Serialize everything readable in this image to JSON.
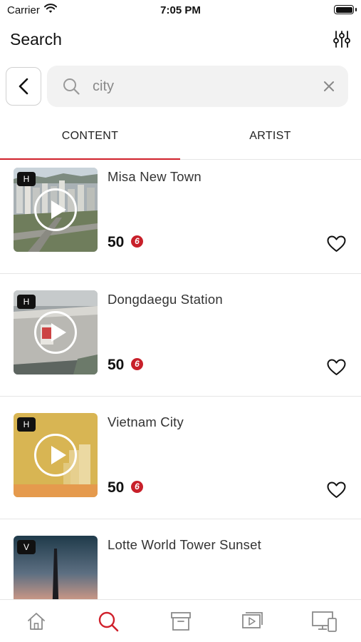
{
  "status_bar": {
    "carrier": "Carrier",
    "time": "7:05 PM"
  },
  "header": {
    "title": "Search"
  },
  "search": {
    "value": "city"
  },
  "tabs": [
    {
      "label": "CONTENT",
      "active": true
    },
    {
      "label": "ARTIST",
      "active": false
    }
  ],
  "results": [
    {
      "title": "Misa New Town",
      "price": "50",
      "badge": "H",
      "coin_symbol": "6"
    },
    {
      "title": "Dongdaegu Station",
      "price": "50",
      "badge": "H",
      "coin_symbol": "6"
    },
    {
      "title": "Vietnam City",
      "price": "50",
      "badge": "H",
      "coin_symbol": "6"
    },
    {
      "title": "Lotte World Tower Sunset",
      "badge": "V"
    }
  ],
  "bottom_nav": [
    {
      "icon": "home-icon",
      "active": false
    },
    {
      "icon": "search-icon",
      "active": true
    },
    {
      "icon": "archive-icon",
      "active": false
    },
    {
      "icon": "media-library-icon",
      "active": false
    },
    {
      "icon": "devices-icon",
      "active": false
    }
  ],
  "colors": {
    "accent": "#d0202b",
    "inactive": "#8a8a8a"
  }
}
